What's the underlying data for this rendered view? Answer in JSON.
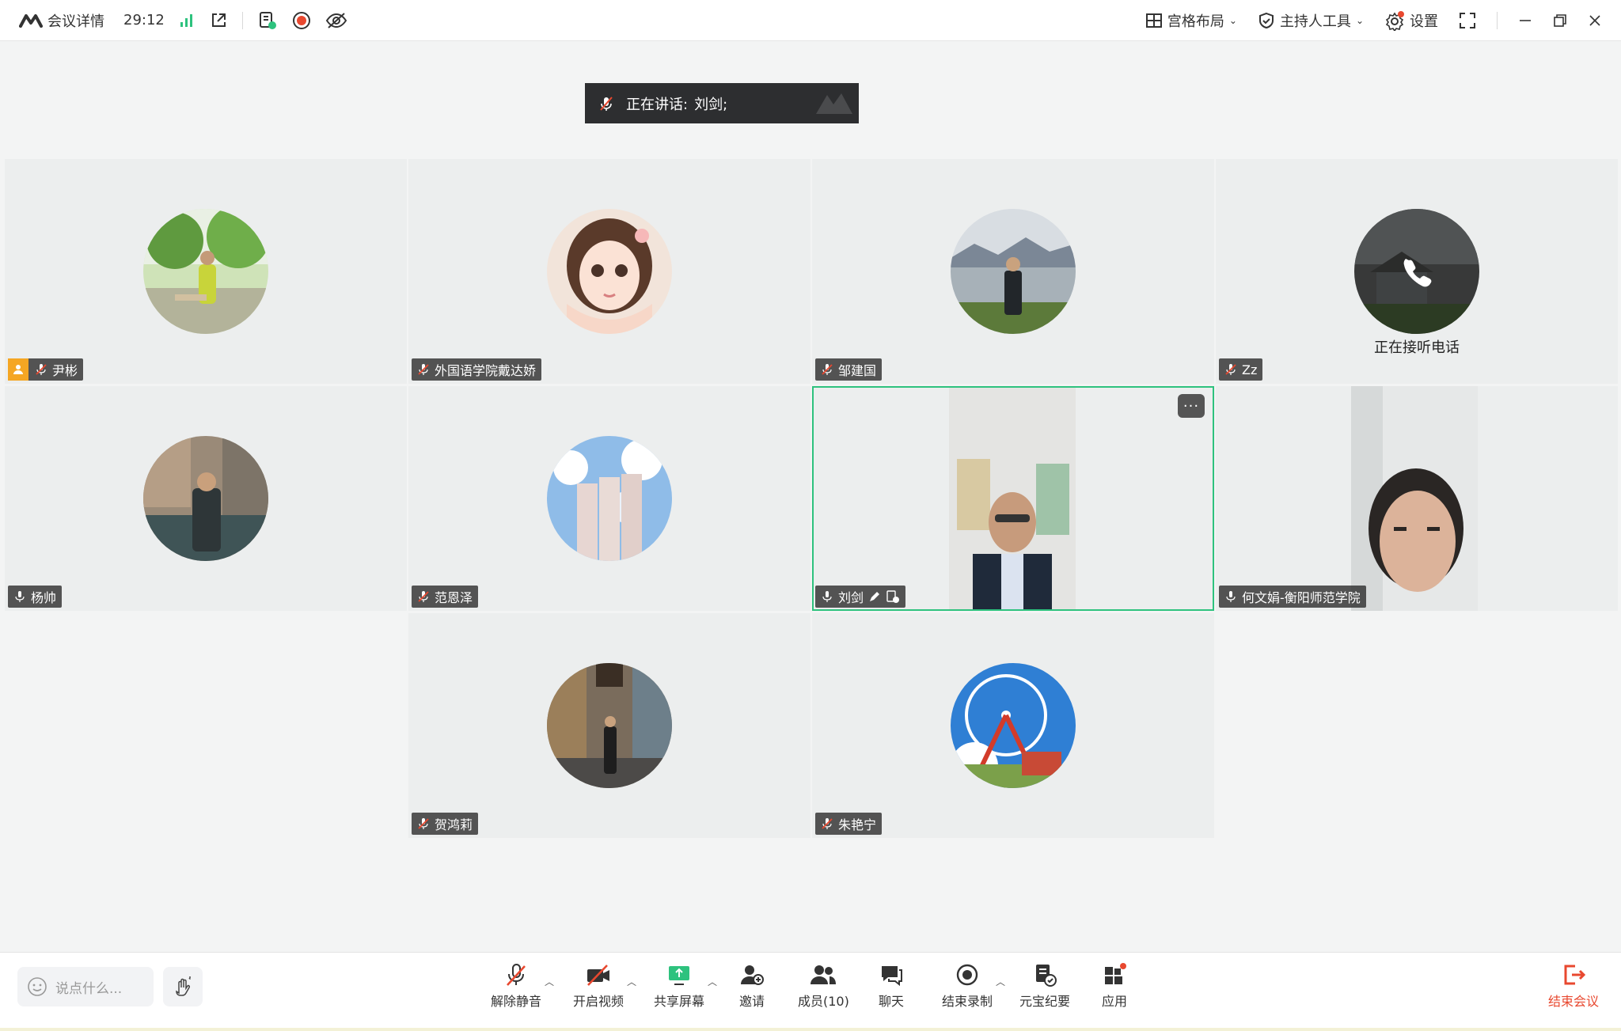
{
  "titlebar": {
    "meeting_details": "会议详情",
    "timer": "29:12",
    "layout": "宫格布局",
    "host_tools": "主持人工具",
    "settings": "设置"
  },
  "speaker": {
    "label": "正在讲话:",
    "name": "刘剑;"
  },
  "participants": [
    {
      "name": "尹彬",
      "mic": "muted",
      "host": true
    },
    {
      "name": "外国语学院戴达娇",
      "mic": "muted"
    },
    {
      "name": "邹建国",
      "mic": "muted"
    },
    {
      "name": "Zz",
      "mic": "muted",
      "status": "正在接听电话"
    },
    {
      "name": "杨帅",
      "mic": "on"
    },
    {
      "name": "范恩泽",
      "mic": "muted"
    },
    {
      "name": "刘剑",
      "mic": "on",
      "video": true,
      "active": true
    },
    {
      "name": "何文娟-衡阳师范学院",
      "mic": "on",
      "video": true
    },
    {
      "name": "贺鸿莉",
      "mic": "muted"
    },
    {
      "name": "朱艳宁",
      "mic": "muted"
    }
  ],
  "toolbar": {
    "chat_placeholder": "说点什么...",
    "unmute": "解除静音",
    "start_video": "开启视频",
    "share_screen": "共享屏幕",
    "invite": "邀请",
    "members": "成员(10)",
    "chat": "聊天",
    "end_recording": "结束录制",
    "ai_minutes": "元宝纪要",
    "apps": "应用",
    "end_meeting": "结束会议"
  },
  "colors": {
    "accent_green": "#2ec27e",
    "danger_red": "#e8482f",
    "host_orange": "#f5a623"
  }
}
